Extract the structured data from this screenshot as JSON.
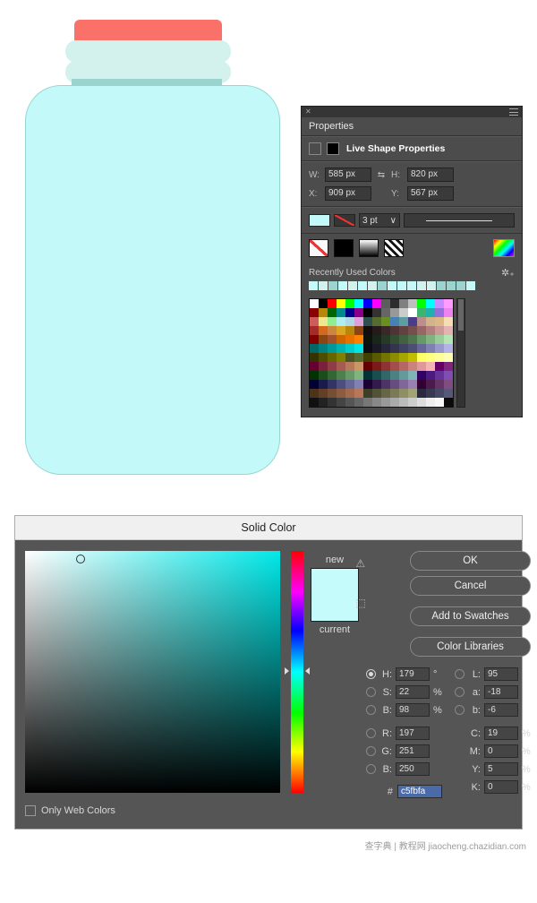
{
  "properties_panel": {
    "title": "Properties",
    "section_title": "Live Shape Properties",
    "w_label": "W:",
    "w_value": "585 px",
    "link_icon": "link-icon",
    "h_label": "H:",
    "h_value": "820 px",
    "x_label": "X:",
    "x_value": "909 px",
    "y_label": "Y:",
    "y_value": "567 px",
    "stroke_width": "3 pt",
    "dropdown_caret": "∨",
    "recent_label": "Recently Used Colors",
    "recent_swatches": [
      "#c5fbfa",
      "#d3f2ee",
      "#9bd4ce",
      "#c4f9f9",
      "#d3f2ee",
      "#c4f9f9",
      "#d3f2ee",
      "#9bd4ce",
      "#c4f9f9",
      "#c4f9f9",
      "#c4f9f9",
      "#d3f2ee",
      "#d3f2ee",
      "#9bd4ce",
      "#9bd4ce",
      "#9bd4ce",
      "#c4f9f9"
    ],
    "palette": [
      "#ffffff",
      "#000000",
      "#ff0000",
      "#ffff00",
      "#00ff00",
      "#00ffff",
      "#0000ff",
      "#ff00ff",
      "#5c5c5c",
      "#2d2d2d",
      "#808080",
      "#bfbfbf",
      "#00ff00",
      "#00ffff",
      "#c78cff",
      "#ff9aff",
      "#8b0000",
      "#b8860b",
      "#006400",
      "#008b8b",
      "#00008b",
      "#8b008b",
      "#000000",
      "#333333",
      "#666666",
      "#999999",
      "#cccccc",
      "#ffffff",
      "#3cb371",
      "#20b2aa",
      "#9370db",
      "#ee82ee",
      "#cd5c5c",
      "#f0e68c",
      "#90ee90",
      "#afeeee",
      "#add8e6",
      "#dda0dd",
      "#2f4f4f",
      "#556b2f",
      "#6b8e23",
      "#4682b4",
      "#5f9ea0",
      "#483d8b",
      "#bc8f8f",
      "#d2b48c",
      "#deb887",
      "#f5deb3",
      "#a52a2a",
      "#d2691e",
      "#cd853f",
      "#daa520",
      "#b8860b",
      "#8b4513",
      "#130c0c",
      "#261a1a",
      "#3a2727",
      "#4e3434",
      "#614141",
      "#754e4e",
      "#996666",
      "#b38080",
      "#cc9999",
      "#e6b3b3",
      "#800000",
      "#8b4513",
      "#a0522d",
      "#cc6600",
      "#e67300",
      "#ff8000",
      "#0c130c",
      "#1a261a",
      "#273a27",
      "#344e34",
      "#416141",
      "#4e754e",
      "#669966",
      "#80b380",
      "#99cc99",
      "#b3e6b3",
      "#006666",
      "#008080",
      "#009999",
      "#00b3b3",
      "#00cccc",
      "#00e6e6",
      "#0c0c13",
      "#1a1a26",
      "#27273a",
      "#34344e",
      "#414161",
      "#4e4e75",
      "#666699",
      "#8080b3",
      "#9999cc",
      "#b3b3e6",
      "#333300",
      "#4d4d00",
      "#666600",
      "#808000",
      "#4b5320",
      "#556b2f",
      "#404000",
      "#595900",
      "#737300",
      "#8c8c00",
      "#a6a600",
      "#bfbf00",
      "#ffff66",
      "#ffff80",
      "#ffff99",
      "#ffffb3",
      "#660033",
      "#7a1f3d",
      "#8e3d47",
      "#a35b52",
      "#b7795c",
      "#cc9766",
      "#660000",
      "#7a1a1a",
      "#8e3333",
      "#a34d4d",
      "#b76666",
      "#cc8080",
      "#e09999",
      "#f5b3b3",
      "#660066",
      "#80267f",
      "#003300",
      "#1a4d1a",
      "#336633",
      "#4d804d",
      "#669966",
      "#80b380",
      "#003333",
      "#1a4d4d",
      "#336666",
      "#4d8080",
      "#669999",
      "#80b3b3",
      "#330066",
      "#4d1a80",
      "#663399",
      "#804db3",
      "#000033",
      "#1a1a4d",
      "#333366",
      "#4d4d80",
      "#666699",
      "#8080b3",
      "#1a0033",
      "#331a4d",
      "#4d3366",
      "#664d80",
      "#806699",
      "#9980b3",
      "#330033",
      "#4d1a4d",
      "#663366",
      "#804d80",
      "#4d3319",
      "#614026",
      "#754e33",
      "#8c5c40",
      "#a3694d",
      "#b97759",
      "#3d3d29",
      "#525238",
      "#666647",
      "#7a7a57",
      "#8f8f66",
      "#a3a375",
      "#29293d",
      "#383852",
      "#474766",
      "#57577a",
      "#111111",
      "#222222",
      "#333333",
      "#444444",
      "#555555",
      "#666666",
      "#777777",
      "#888888",
      "#999999",
      "#aaaaaa",
      "#bbbbbb",
      "#cccccc",
      "#dddddd",
      "#eeeeee",
      "#f7f7f7",
      "#0a0a0a"
    ]
  },
  "solid_color": {
    "title": "Solid Color",
    "btn_ok": "OK",
    "btn_cancel": "Cancel",
    "btn_add": "Add to Swatches",
    "btn_libs": "Color Libraries",
    "new_label": "new",
    "current_label": "current",
    "owc_label": "Only Web Colors",
    "H_label": "H:",
    "H_val": "179",
    "H_unit": "°",
    "S_label": "S:",
    "S_val": "22",
    "S_unit": "%",
    "B_label": "B:",
    "B_val": "98",
    "B_unit": "%",
    "R_label": "R:",
    "R_val": "197",
    "G_label": "G:",
    "G_val": "251",
    "Bl_label": "B:",
    "Bl_val": "250",
    "L_label": "L:",
    "L_val": "95",
    "a_label": "a:",
    "a_val": "-18",
    "b2_label": "b:",
    "b2_val": "-6",
    "C_label": "C:",
    "C_val": "19",
    "C_unit": "%",
    "M_label": "M:",
    "M_val": "0",
    "M_unit": "%",
    "Y_label": "Y:",
    "Y_val": "5",
    "Y_unit": "%",
    "K_label": "K:",
    "K_val": "0",
    "K_unit": "%",
    "hash": "#",
    "hex": "c5fbfa"
  },
  "footer": {
    "watermark": "查字典 | 教程网   jiaocheng.chazidian.com"
  },
  "chart_data": null
}
